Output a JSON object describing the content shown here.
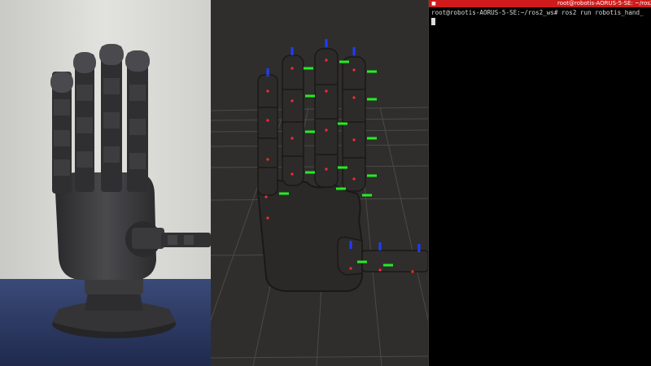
{
  "terminal": {
    "title": "root@robotis-AORUS-5-SE: ~/ros2_w",
    "prompt_user_host": "root@robotis-AORUS-5-SE",
    "prompt_path": ":~/ros2_ws#",
    "command": "ros2 run robotis_hand_",
    "icon": "terminal-icon"
  },
  "colors": {
    "terminal_title_bg": "#cf1b1b",
    "rviz_bg": "#302e2c",
    "axis_x": "#ff2b2b",
    "axis_y": "#22ee22",
    "axis_z": "#1f3cff"
  }
}
